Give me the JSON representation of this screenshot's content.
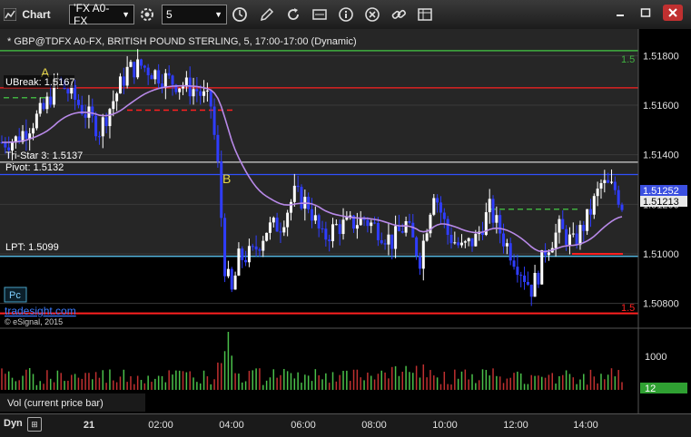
{
  "window": {
    "title": "Chart",
    "symbol": "ʼFX A0-FX",
    "interval": "5",
    "toolbar_icons": [
      "settings-icon",
      "clock-icon",
      "pencil-icon",
      "refresh-icon",
      "market-depth-icon",
      "info-icon",
      "close-circle-icon",
      "link-icon",
      "table-icon"
    ],
    "window_buttons": [
      "minimize-icon",
      "maximize-icon",
      "close-icon"
    ]
  },
  "header": {
    "description": "* GBP@TDFX A0-FX, BRITISH POUND STERLING, 5, 17:00-17:00 (Dynamic)"
  },
  "annotations": {
    "ubreak_label": "UBreak: 1.5167",
    "tristar_label": "Tri-Star 3: 1.5137",
    "pivot_label": "Pivot: 1.5132",
    "lpt_label": "LPT: 1.5099",
    "letter_a": "A",
    "letter_b": "B",
    "pc_label": "Pc",
    "brand": "tradesight.com",
    "copyright": "© eSignal, 2015",
    "right_edge_marker": "1.5",
    "last_price_label": "1.51252",
    "last_price_label2": "1.51213",
    "vol_label": "Vol (current price bar)",
    "vol_value": "12",
    "vol_axis_label": "1000"
  },
  "chart_data": {
    "type": "candlestick",
    "yaxis_ticks": [
      "1.51800",
      "1.51600",
      "1.51400",
      "1.51200",
      "1.51000",
      "1.50800"
    ],
    "ylim": [
      1.507,
      1.519
    ],
    "xaxis_ticks": [
      "21",
      "02:00",
      "04:00",
      "06:00",
      "08:00",
      "10:00",
      "12:00",
      "14:00"
    ],
    "levels": [
      {
        "name": "UBreak",
        "value": 1.5167,
        "color": "#ff2020"
      },
      {
        "name": "Tri-Star 3",
        "value": 1.5137,
        "color": "#d0d0d0"
      },
      {
        "name": "Pivot",
        "value": 1.5132,
        "color": "#3050ff"
      },
      {
        "name": "LPT",
        "value": 1.5099,
        "color": "#60d0ff"
      }
    ],
    "price_path": [
      [
        0,
        1.5145
      ],
      [
        4,
        1.5146
      ],
      [
        8,
        1.5152
      ],
      [
        12,
        1.5158
      ],
      [
        16,
        1.517
      ],
      [
        20,
        1.5164
      ],
      [
        24,
        1.5157
      ],
      [
        28,
        1.515
      ],
      [
        32,
        1.5162
      ],
      [
        36,
        1.5174
      ],
      [
        40,
        1.5176
      ],
      [
        44,
        1.5173
      ],
      [
        48,
        1.517
      ],
      [
        52,
        1.5168
      ],
      [
        56,
        1.5166
      ],
      [
        60,
        1.516
      ],
      [
        62,
        1.5135
      ],
      [
        64,
        1.5095
      ],
      [
        66,
        1.5084
      ],
      [
        68,
        1.5098
      ],
      [
        72,
        1.51
      ],
      [
        76,
        1.511
      ],
      [
        80,
        1.5112
      ],
      [
        84,
        1.5124
      ],
      [
        88,
        1.512
      ],
      [
        92,
        1.5106
      ],
      [
        96,
        1.5111
      ],
      [
        100,
        1.5112
      ],
      [
        104,
        1.5114
      ],
      [
        108,
        1.511
      ],
      [
        112,
        1.5105
      ],
      [
        116,
        1.5112
      ],
      [
        120,
        1.5098
      ],
      [
        124,
        1.5126
      ],
      [
        128,
        1.5108
      ],
      [
        132,
        1.5102
      ],
      [
        136,
        1.5106
      ],
      [
        140,
        1.5118
      ],
      [
        144,
        1.5106
      ],
      [
        148,
        1.5096
      ],
      [
        152,
        1.5086
      ],
      [
        154,
        1.5092
      ],
      [
        156,
        1.5102
      ],
      [
        160,
        1.511
      ],
      [
        164,
        1.5104
      ],
      [
        168,
        1.5114
      ],
      [
        172,
        1.5128
      ],
      [
        176,
        1.5126
      ],
      [
        178,
        1.512
      ]
    ],
    "volume_axis_ticks": [
      "1000"
    ]
  }
}
